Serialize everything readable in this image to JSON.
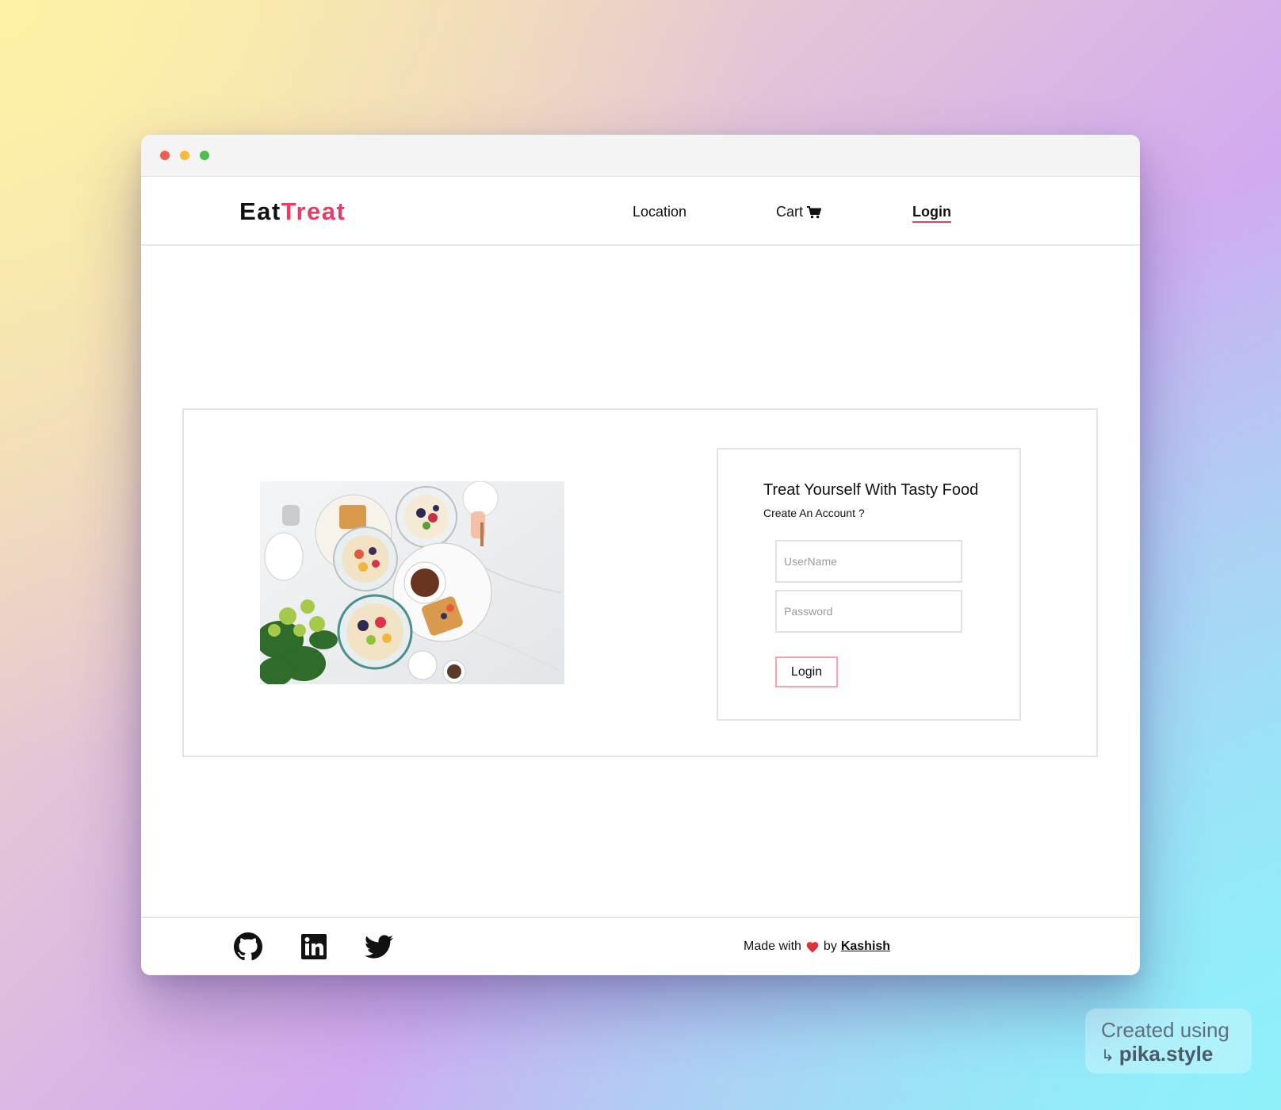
{
  "brand": {
    "part1": "Eat",
    "part2": "Treat"
  },
  "nav": {
    "location": "Location",
    "cart": "Cart",
    "login": "Login"
  },
  "login_card": {
    "title": "Treat Yourself With Tasty Food",
    "subtitle": "Create An Account ?",
    "username_placeholder": "UserName",
    "password_placeholder": "Password",
    "button_label": "Login"
  },
  "footer": {
    "made_with": "Made with",
    "by": "by",
    "author": "Kashish",
    "socials": [
      "github-icon",
      "linkedin-icon",
      "twitter-icon"
    ]
  },
  "watermark": {
    "line1": "Created using",
    "line2": "pika.style"
  },
  "colors": {
    "accent": "#e53d63",
    "button_border": "#f4a3b3",
    "heart": "#e0303a",
    "dot_red": "#ee5e55",
    "dot_yellow": "#f4bb3b",
    "dot_green": "#4fbf4c"
  }
}
